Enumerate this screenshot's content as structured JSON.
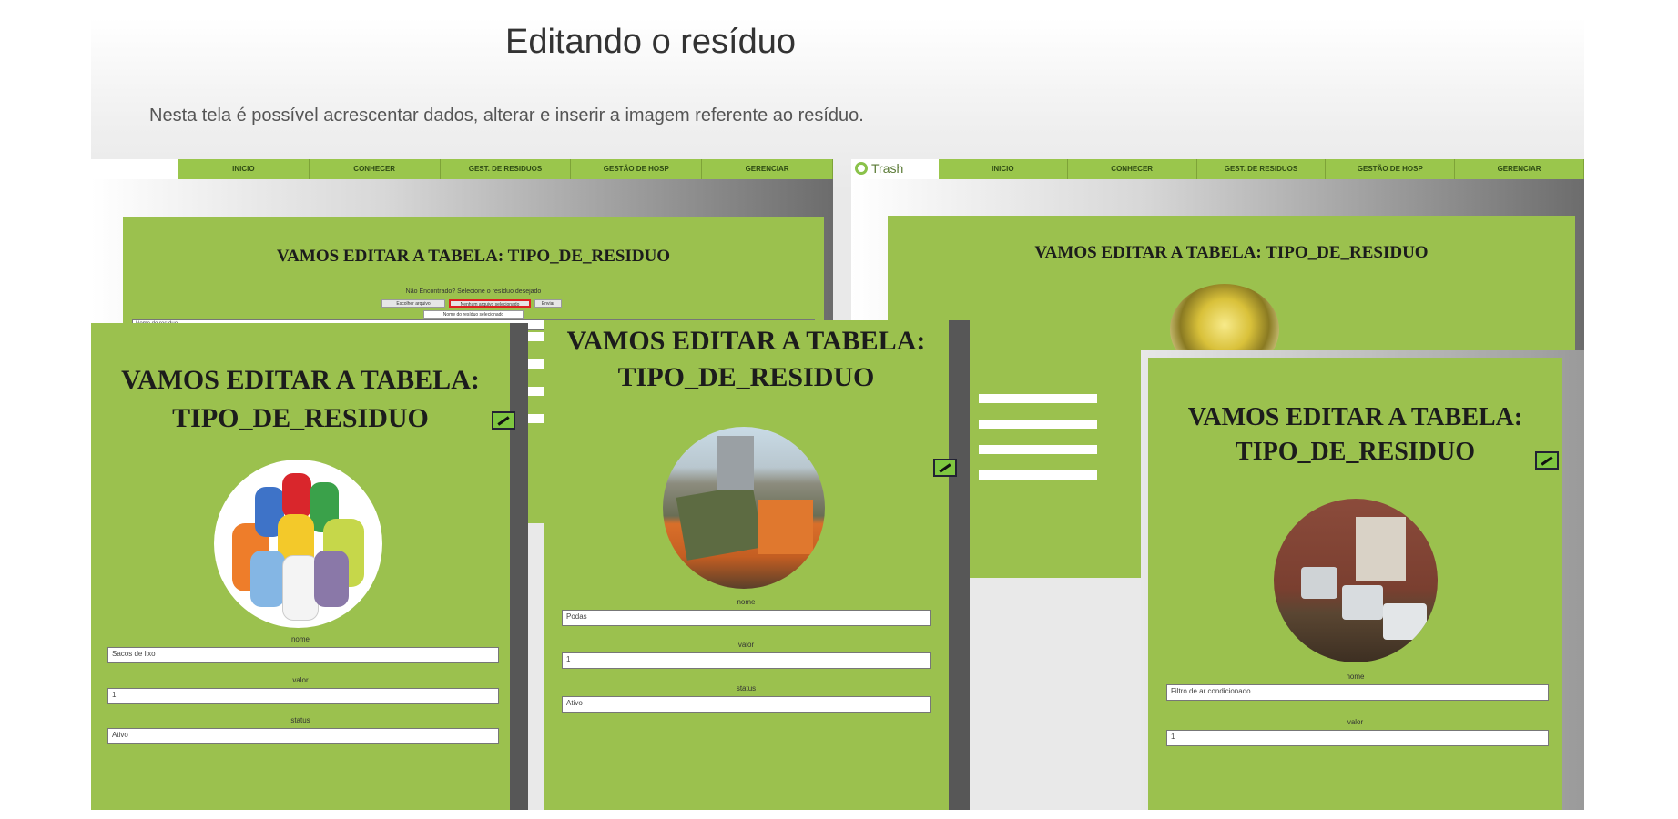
{
  "slide": {
    "title": "Editando o resíduo",
    "subtitle": "Nesta tela é possível acrescentar dados, alterar e inserir a imagem referente ao resíduo."
  },
  "nav": [
    "INICIO",
    "CONHECER",
    "GEST. DE RESIDUOS",
    "GESTÃO DE HOSP",
    "GERENCIAR"
  ],
  "logo_text": "Trash",
  "form_heading": "VAMOS EDITAR A TABELA: TIPO_DE_RESIDUO",
  "form_heading_line1": "VAMOS EDITAR A TABELA:",
  "form_heading_line2": "TIPO_DE_RESIDUO",
  "top_left": {
    "hint": "Não Encontrado? Selecione o resíduo desejado",
    "search_value": "Nome do resíduo",
    "buttons": [
      "Escolher arquivo",
      "Nenhum arquivo selecionado",
      "Enviar"
    ],
    "dropdown": "Nome do resíduo selecionado"
  },
  "fields": {
    "nome_label": "nome",
    "valor_label": "valor",
    "status_label": "status"
  },
  "card1": {
    "nome": "Sacos de lixo",
    "valor": "1",
    "status": "Ativo"
  },
  "card2": {
    "nome": "Podas",
    "valor": "1",
    "status": "Ativo"
  },
  "card3": {
    "nome": "Filtro de ar condicionado",
    "valor": "1"
  },
  "colors": {
    "green": "#9bc14e",
    "nav_green": "#9ac64c",
    "dark_text": "#1c1c1c"
  }
}
